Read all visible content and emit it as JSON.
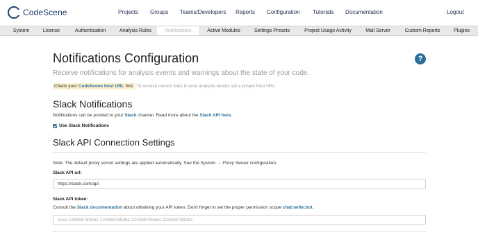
{
  "app": {
    "logo_text": "CodeScene"
  },
  "topnav": [
    {
      "label": "Projects"
    },
    {
      "label": "Groups"
    },
    {
      "label": "Teams/Developers"
    },
    {
      "label": "Reports"
    },
    {
      "label": "Configuration"
    },
    {
      "label": "Tutorials"
    },
    {
      "label": "Documentation"
    }
  ],
  "logout_label": "Logout",
  "subnav": [
    {
      "label": "System"
    },
    {
      "label": "License"
    },
    {
      "label": "Authentication"
    },
    {
      "label": "Analysis Rules"
    },
    {
      "label": "Notifications",
      "active": true
    },
    {
      "label": "Active Modules"
    },
    {
      "label": "Settings Presets"
    },
    {
      "label": "Project Usage Activity"
    },
    {
      "label": "Mail Server"
    },
    {
      "label": "Custom Reports"
    },
    {
      "label": "Plugins"
    }
  ],
  "page": {
    "title": "Notifications Configuration",
    "subtitle": "Receive notifications for analysis events and warnings about the state of your code.",
    "hint_prefix": "Check your ",
    "hint_link": "CodeScene host URL",
    "hint_suffix": " first.",
    "hint_rest": "To receive correct links to your analysis results set a proper host URL.",
    "help_glyph": "?"
  },
  "slack": {
    "title": "Slack Notifications",
    "desc_1": "Notifications can be pushed to your ",
    "desc_link_1": "Slack",
    "desc_2": " channel. Read more about the ",
    "desc_link_2": "Slack API here",
    "desc_3": ".",
    "checkbox_label": "Use Slack Notifications",
    "checkbox_checked": true
  },
  "api": {
    "title": "Slack API Connection Settings",
    "note_1": "Note: The default proxy server settings are applied automatically. See the ",
    "note_em": "System → Proxy Server",
    "note_2": " configuration.",
    "url_label": "Slack API url:",
    "url_value": "https://slack.com/api",
    "token_label": "Slack API token:",
    "token_desc_1": "Consult the ",
    "token_desc_link": "Slack documentation",
    "token_desc_2": " about obtaining your API token. Don't forget to set the proper permission scope ",
    "token_desc_scope": "chat:write:bot",
    "token_desc_3": ".",
    "token_placeholder": "xoxs-123456789abc-123456789abc-123456789abc-123456789abc"
  },
  "colors": {
    "brand": "#1f3b6b",
    "link": "#2a6f97",
    "hint_bg": "#fdf2cf",
    "subnav_bg": "#e8e8e8"
  }
}
